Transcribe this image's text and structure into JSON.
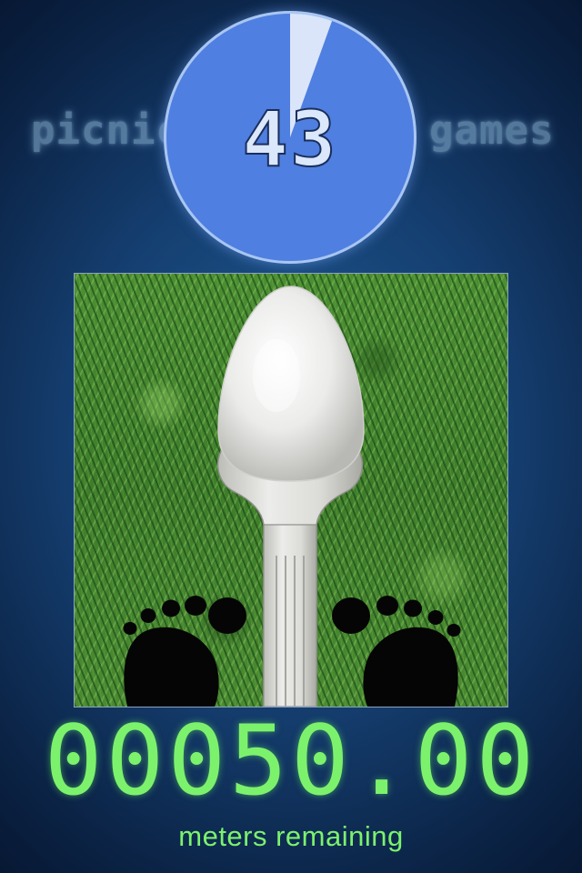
{
  "header": {
    "left_word": "picnic",
    "right_word": "games",
    "timer_value": "43",
    "timer_fraction_elapsed": 0.055
  },
  "game": {
    "items": [
      "spoon",
      "egg",
      "left-footprint",
      "right-footprint",
      "grass"
    ]
  },
  "score": {
    "distance": "00050.00",
    "label": "meters remaining"
  },
  "colors": {
    "background": "#153f71",
    "timer_fill": "#4f7fe0",
    "digit_green": "#7cf26c",
    "side_text": "#8db8d6"
  }
}
